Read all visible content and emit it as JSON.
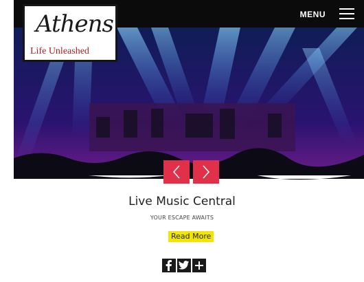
{
  "header": {
    "menu_label": "MENU",
    "logo_script": "Athens",
    "logo_tagline": "Life Unleashed",
    "brand_red": "#b01f2a"
  },
  "carousel": {
    "prev_icon": "chevron-left-icon",
    "next_icon": "chevron-right-icon",
    "arrow_color": "#e0304a"
  },
  "content": {
    "title": "Live Music Central",
    "subtitle": "YOUR ESCAPE AWAITS",
    "read_more": "Read More",
    "read_more_color": "#f2e600"
  },
  "share": {
    "icons": [
      "facebook-icon",
      "twitter-icon",
      "plus-icon"
    ]
  }
}
